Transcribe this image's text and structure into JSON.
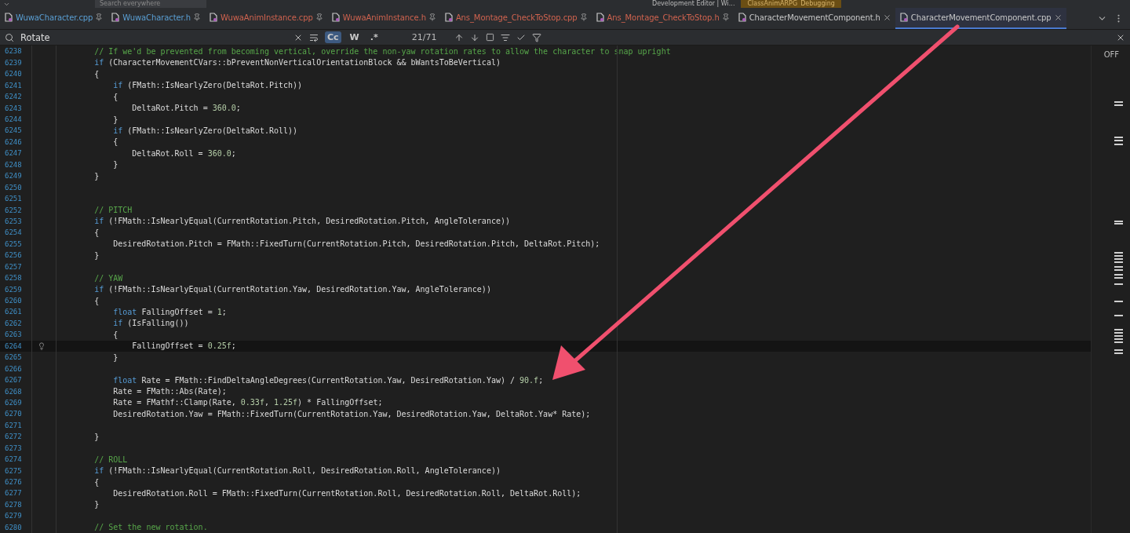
{
  "top_toolbar": {
    "search_placeholder": "Search everywhere",
    "run_config": "Development Editor | Wi...",
    "debug_target": "ClassAnimARPG",
    "debug_state": "Debugging"
  },
  "tabs": [
    {
      "label": "WuwaCharacter.cpp",
      "color": "#5a9fd4",
      "pinned": true,
      "selected": false
    },
    {
      "label": "WuwaCharacter.h",
      "color": "#5a9fd4",
      "pinned": true,
      "selected": false
    },
    {
      "label": "WuwaAnimInstance.cpp",
      "color": "#d0634f",
      "pinned": true,
      "selected": false
    },
    {
      "label": "WuwaAnimInstance.h",
      "color": "#d0634f",
      "pinned": true,
      "selected": false
    },
    {
      "label": "Ans_Montage_CheckToStop.cpp",
      "color": "#d0634f",
      "pinned": true,
      "selected": false
    },
    {
      "label": "Ans_Montage_CheckToStop.h",
      "color": "#d0634f",
      "pinned": true,
      "selected": false
    },
    {
      "label": "CharacterMovementComponent.h",
      "color": "#c8c8c8",
      "pinned": false,
      "selected": false
    },
    {
      "label": "CharacterMovementComponent.cpp",
      "color": "#c8c8c8",
      "pinned": false,
      "selected": true
    }
  ],
  "find_bar": {
    "value": "Rotate",
    "toggles": [
      {
        "label": "Cc",
        "on": true
      },
      {
        "label": "W",
        "on": false
      },
      {
        "label": ".*",
        "on": false
      }
    ],
    "match_count": "21/71"
  },
  "inlay_hints": "OFF",
  "lines": [
    {
      "number": "6238",
      "current": false,
      "code": [
        {
          "kind": "comment",
          "text": "        // If we'd be prevented from becoming vertical, override the non-yaw rotation rates to allow the character to snap upright"
        }
      ]
    },
    {
      "number": "6239",
      "current": false,
      "code": [
        {
          "kind": "keyword",
          "text": "        if"
        },
        {
          "kind": "plain",
          "text": " (CharacterMovementCVars::bPreventNonVerticalOrientationBlock && bWantsToBeVertical)"
        }
      ]
    },
    {
      "number": "6240",
      "current": false,
      "code": [
        {
          "kind": "plain",
          "text": "        {"
        }
      ]
    },
    {
      "number": "6241",
      "current": false,
      "code": [
        {
          "kind": "keyword",
          "text": "            if"
        },
        {
          "kind": "plain",
          "text": " (FMath::IsNearlyZero(DeltaRot.Pitch))"
        }
      ]
    },
    {
      "number": "6242",
      "current": false,
      "code": [
        {
          "kind": "plain",
          "text": "            {"
        }
      ]
    },
    {
      "number": "6243",
      "current": false,
      "code": [
        {
          "kind": "plain",
          "text": "                DeltaRot.Pitch = "
        },
        {
          "kind": "number",
          "text": "360.0"
        },
        {
          "kind": "plain",
          "text": ";"
        }
      ]
    },
    {
      "number": "6244",
      "current": false,
      "code": [
        {
          "kind": "plain",
          "text": "            }"
        }
      ]
    },
    {
      "number": "6245",
      "current": false,
      "code": [
        {
          "kind": "keyword",
          "text": "            if"
        },
        {
          "kind": "plain",
          "text": " (FMath::IsNearlyZero(DeltaRot.Roll))"
        }
      ]
    },
    {
      "number": "6246",
      "current": false,
      "code": [
        {
          "kind": "plain",
          "text": "            {"
        }
      ]
    },
    {
      "number": "6247",
      "current": false,
      "code": [
        {
          "kind": "plain",
          "text": "                DeltaRot.Roll = "
        },
        {
          "kind": "number",
          "text": "360.0"
        },
        {
          "kind": "plain",
          "text": ";"
        }
      ]
    },
    {
      "number": "6248",
      "current": false,
      "code": [
        {
          "kind": "plain",
          "text": "            }"
        }
      ]
    },
    {
      "number": "6249",
      "current": false,
      "code": [
        {
          "kind": "plain",
          "text": "        }"
        }
      ]
    },
    {
      "number": "6250",
      "current": false
    },
    {
      "number": "6251",
      "current": false
    },
    {
      "number": "6252",
      "current": false,
      "code": [
        {
          "kind": "comment",
          "text": "        // PITCH"
        }
      ]
    },
    {
      "number": "6253",
      "current": false,
      "code": [
        {
          "kind": "keyword",
          "text": "        if"
        },
        {
          "kind": "plain",
          "text": " (!FMath::IsNearlyEqual(CurrentRotation.Pitch, DesiredRotation.Pitch, AngleTolerance))"
        }
      ]
    },
    {
      "number": "6254",
      "current": false,
      "code": [
        {
          "kind": "plain",
          "text": "        {"
        }
      ]
    },
    {
      "number": "6255",
      "current": false,
      "code": [
        {
          "kind": "plain",
          "text": "            DesiredRotation.Pitch = FMath::FixedTurn(CurrentRotation.Pitch, DesiredRotation.Pitch, DeltaRot.Pitch);"
        }
      ]
    },
    {
      "number": "6256",
      "current": false,
      "code": [
        {
          "kind": "plain",
          "text": "        }"
        }
      ]
    },
    {
      "number": "6257",
      "current": false
    },
    {
      "number": "6258",
      "current": false,
      "code": [
        {
          "kind": "comment",
          "text": "        // YAW"
        }
      ]
    },
    {
      "number": "6259",
      "current": false,
      "code": [
        {
          "kind": "keyword",
          "text": "        if"
        },
        {
          "kind": "plain",
          "text": " (!FMath::IsNearlyEqual(CurrentRotation.Yaw, DesiredRotation.Yaw, AngleTolerance))"
        }
      ]
    },
    {
      "number": "6260",
      "current": false,
      "code": [
        {
          "kind": "plain",
          "text": "        {"
        }
      ]
    },
    {
      "number": "6261",
      "current": false,
      "code": [
        {
          "kind": "keyword",
          "text": "            float"
        },
        {
          "kind": "plain",
          "text": " FallingOffset = "
        },
        {
          "kind": "number",
          "text": "1"
        },
        {
          "kind": "plain",
          "text": ";"
        }
      ]
    },
    {
      "number": "6262",
      "current": false,
      "code": [
        {
          "kind": "keyword",
          "text": "            if"
        },
        {
          "kind": "plain",
          "text": " (IsFalling())"
        }
      ]
    },
    {
      "number": "6263",
      "current": false,
      "code": [
        {
          "kind": "plain",
          "text": "            {"
        }
      ]
    },
    {
      "number": "6264",
      "current": true,
      "code": [
        {
          "kind": "plain",
          "text": "                FallingOffset = "
        },
        {
          "kind": "number",
          "text": "0.25f"
        },
        {
          "kind": "plain",
          "text": ";"
        }
      ]
    },
    {
      "number": "6265",
      "current": false,
      "code": [
        {
          "kind": "plain",
          "text": "            }"
        }
      ]
    },
    {
      "number": "6266",
      "current": false
    },
    {
      "number": "6267",
      "current": false,
      "code": [
        {
          "kind": "keyword",
          "text": "            float"
        },
        {
          "kind": "plain",
          "text": " Rate = FMath::FindDeltaAngleDegrees(CurrentRotation.Yaw, DesiredRotation.Yaw) / "
        },
        {
          "kind": "number",
          "text": "90.f"
        },
        {
          "kind": "plain",
          "text": ";"
        }
      ]
    },
    {
      "number": "6268",
      "current": false,
      "code": [
        {
          "kind": "plain",
          "text": "            Rate = FMath::Abs(Rate);"
        }
      ]
    },
    {
      "number": "6269",
      "current": false,
      "code": [
        {
          "kind": "plain",
          "text": "            Rate = FMathf::Clamp(Rate, "
        },
        {
          "kind": "number",
          "text": "0.33f"
        },
        {
          "kind": "plain",
          "text": ", "
        },
        {
          "kind": "number",
          "text": "1.25f"
        },
        {
          "kind": "plain",
          "text": ") * FallingOffset;"
        }
      ]
    },
    {
      "number": "6270",
      "current": false,
      "code": [
        {
          "kind": "plain",
          "text": "            DesiredRotation.Yaw = FMath::FixedTurn(CurrentRotation.Yaw, DesiredRotation.Yaw, DeltaRot.Yaw* Rate);"
        }
      ]
    },
    {
      "number": "6271",
      "current": false
    },
    {
      "number": "6272",
      "current": false,
      "code": [
        {
          "kind": "plain",
          "text": "        }"
        }
      ]
    },
    {
      "number": "6273",
      "current": false
    },
    {
      "number": "6274",
      "current": false,
      "code": [
        {
          "kind": "comment",
          "text": "        // ROLL"
        }
      ]
    },
    {
      "number": "6275",
      "current": false,
      "code": [
        {
          "kind": "keyword",
          "text": "        if"
        },
        {
          "kind": "plain",
          "text": " (!FMath::IsNearlyEqual(CurrentRotation.Roll, DesiredRotation.Roll, AngleTolerance))"
        }
      ]
    },
    {
      "number": "6276",
      "current": false,
      "code": [
        {
          "kind": "plain",
          "text": "        {"
        }
      ]
    },
    {
      "number": "6277",
      "current": false,
      "code": [
        {
          "kind": "plain",
          "text": "            DesiredRotation.Roll = FMath::FixedTurn(CurrentRotation.Roll, DesiredRotation.Roll, DeltaRot.Roll);"
        }
      ]
    },
    {
      "number": "6278",
      "current": false,
      "code": [
        {
          "kind": "plain",
          "text": "        }"
        }
      ]
    },
    {
      "number": "6279",
      "current": false
    },
    {
      "number": "6280",
      "current": false,
      "code": [
        {
          "kind": "comment",
          "text": "        // Set the new rotation."
        }
      ]
    }
  ]
}
